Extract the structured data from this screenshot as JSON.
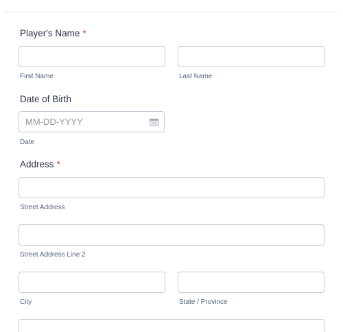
{
  "form": {
    "players_name": {
      "label": "Player's Name",
      "required_mark": "*",
      "first_name_value": "",
      "last_name_value": "",
      "first_name_sublabel": "First Name",
      "last_name_sublabel": "Last Name"
    },
    "date_of_birth": {
      "label": "Date of Birth",
      "placeholder": "MM-DD-YYYY",
      "value": "",
      "sublabel": "Date",
      "icon": "calendar-icon"
    },
    "address": {
      "label": "Address",
      "required_mark": "*",
      "street_value": "",
      "street_sublabel": "Street Address",
      "street2_value": "",
      "street2_sublabel": "Street Address Line 2",
      "city_value": "",
      "city_sublabel": "City",
      "state_value": "",
      "state_sublabel": "State / Province",
      "postal_value": ""
    }
  },
  "colors": {
    "required": "#d63b3b",
    "border": "#c3cad8",
    "label": "#2c3345",
    "sublabel": "#57647e"
  }
}
